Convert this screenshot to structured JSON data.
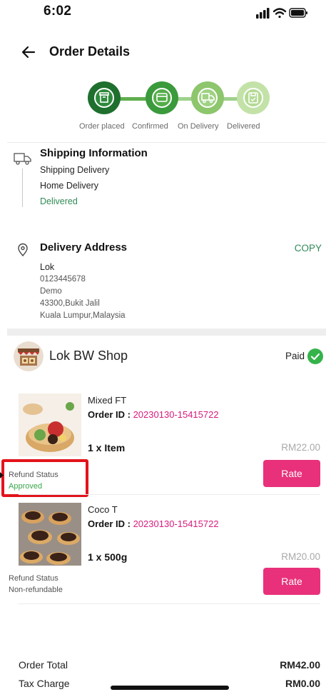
{
  "status_bar": {
    "time": "6:02"
  },
  "header": {
    "title": "Order Details"
  },
  "stepper": {
    "steps": [
      {
        "label": "Order placed",
        "icon": "box-icon"
      },
      {
        "label": "Confirmed",
        "icon": "card-icon"
      },
      {
        "label": "On Delivery",
        "icon": "truck-icon"
      },
      {
        "label": "Delivered",
        "icon": "package-icon"
      }
    ]
  },
  "shipping": {
    "title": "Shipping Information",
    "method": "Shipping Delivery",
    "type": "Home Delivery",
    "status": "Delivered"
  },
  "address": {
    "title": "Delivery Address",
    "copy_label": "COPY",
    "name": "Lok",
    "phone": "0123445678",
    "line1": "Demo",
    "line2": "43300,Bukit Jalil",
    "line3": "Kuala Lumpur,Malaysia"
  },
  "shop": {
    "name": "Lok BW Shop",
    "payment_status": "Paid"
  },
  "items": [
    {
      "name": "Mixed FT",
      "order_id_label": "Order ID : ",
      "order_id": "20230130-15415722",
      "quantity": "1 x Item",
      "price": "RM22.00",
      "refund_label": "Refund Status",
      "refund_status": "Approved",
      "rate_label": "Rate"
    },
    {
      "name": "Coco T",
      "order_id_label": "Order ID : ",
      "order_id": "20230130-15415722",
      "quantity": "1 x 500g",
      "price": "RM20.00",
      "refund_label": "Refund Status",
      "refund_status": "Non-refundable",
      "rate_label": "Rate"
    }
  ],
  "totals": {
    "order_total_label": "Order Total",
    "order_total": "RM42.00",
    "tax_label": "Tax Charge",
    "tax": "RM0.00"
  },
  "colors": {
    "accent_green": "#2f8a57",
    "step_done_dark": "#1f7a31",
    "step_light": "#8fc870",
    "brand_pink": "#e8317a",
    "order_id_pink": "#d81b7d",
    "approved_green": "#3aa64a",
    "highlight_red": "#e3131b"
  }
}
